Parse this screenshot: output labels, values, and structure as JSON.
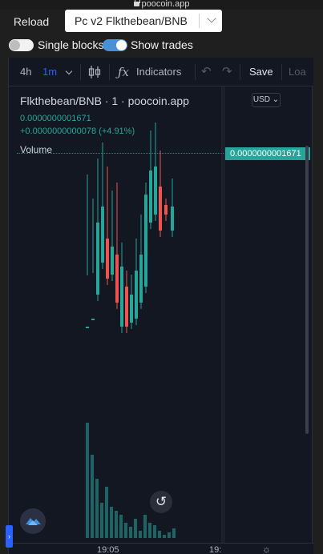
{
  "browser": {
    "url": "poocoin.app"
  },
  "controls": {
    "reload_label": "Reload",
    "pair_value": "Pc v2 Flkthebean/BNB",
    "toggle_single_blocks": {
      "label": "Single blocks",
      "on": false
    },
    "toggle_show_trades": {
      "label": "Show trades",
      "on": true
    }
  },
  "toolbar": {
    "interval_4h": "4h",
    "interval_1m": "1m",
    "indicators_label": "Indicators",
    "save_label": "Save",
    "load_label": "Loa"
  },
  "legend": {
    "title": "Flkthebean/BNB · 1 · poocoin.app",
    "price": "0.0000000001671",
    "change": "+0.0000000000078 (+4.91%)",
    "volume_label": "Volume"
  },
  "price_axis": {
    "currency": "USD",
    "last_price_tag": "0.0000000001671"
  },
  "time_axis": {
    "labels": [
      "19:05",
      "19:"
    ]
  },
  "colors": {
    "up": "#26a69a",
    "down": "#ef5350",
    "background": "#131722",
    "accent": "#2962ff"
  }
}
